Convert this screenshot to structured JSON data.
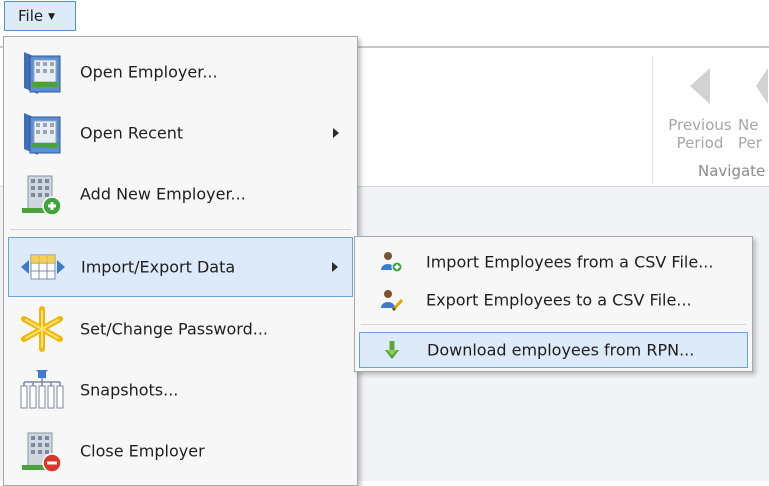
{
  "file_menu_button": {
    "label": "File"
  },
  "ribbon": {
    "previous_period": [
      "Previous",
      "Period"
    ],
    "next_period": [
      "Ne",
      "Per"
    ],
    "group_label": "Navigate"
  },
  "file_menu": {
    "items": [
      {
        "label": "Open Employer...",
        "icon": "open-employer-icon"
      },
      {
        "label": "Open Recent",
        "icon": "open-recent-icon",
        "submenu": true
      },
      {
        "label": "Add New Employer...",
        "icon": "add-employer-icon"
      },
      {
        "label": "Import/Export Data",
        "icon": "import-export-icon",
        "submenu": true,
        "highlighted": true
      },
      {
        "label": "Set/Change Password...",
        "icon": "password-icon"
      },
      {
        "label": "Snapshots...",
        "icon": "snapshots-icon"
      },
      {
        "label": "Close Employer",
        "icon": "close-employer-icon"
      }
    ]
  },
  "import_export_submenu": {
    "items": [
      {
        "label": "Import Employees from a CSV File...",
        "icon": "import-employees-icon"
      },
      {
        "label": "Export Employees to a CSV File...",
        "icon": "export-employees-icon"
      },
      {
        "label": "Download employees from RPN...",
        "icon": "download-arrow-icon",
        "highlighted": true
      }
    ]
  },
  "colors": {
    "highlight_bg": "#dceaf9",
    "highlight_border": "#6aa2e0",
    "accent_green": "#3da63a",
    "accent_red": "#d9362c"
  }
}
